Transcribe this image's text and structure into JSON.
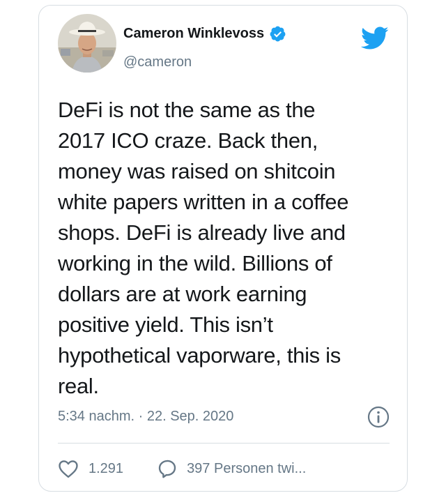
{
  "author": {
    "name": "Cameron Winklevoss",
    "handle": "@cameron",
    "verified": true,
    "avatar_icon": "profile-photo"
  },
  "brand": {
    "icon": "twitter-bird-icon",
    "color": "#1da1f2"
  },
  "tweet": {
    "lines": [
      "DeFi is not the same as the",
      "2017 ICO craze. Back then,",
      "money was raised on shitcoin",
      "white papers written in a coffee",
      "shops. DeFi is already live and",
      "working in the wild. Billions of",
      "dollars are at work earning",
      "positive yield. This isn’t",
      "hypothetical vaporware, this is",
      "real."
    ]
  },
  "meta": {
    "timestamp": "5:34 nachm. · 22. Sep. 2020",
    "info_icon": "info-icon"
  },
  "actions": {
    "like_count": "1.291",
    "reply_label": "397 Personen twi..."
  },
  "colors": {
    "text_primary": "#14171a",
    "text_secondary": "#657786",
    "border": "#d7dde2",
    "verified_blue": "#1da1f2"
  }
}
